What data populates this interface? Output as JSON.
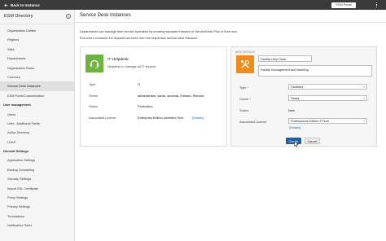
{
  "topbar": {
    "back_label": "Back to Instance",
    "portal_button": "ESM Portal"
  },
  "sidebar": {
    "title": "ESM Directory",
    "help_icon": "?",
    "items": [
      {
        "label": "Organization Details",
        "type": "item"
      },
      {
        "label": "Regions",
        "type": "item"
      },
      {
        "label": "Sites",
        "type": "item"
      },
      {
        "label": "Departments",
        "type": "item"
      },
      {
        "label": "Organization Roles",
        "type": "item"
      },
      {
        "label": "Currency",
        "type": "item"
      },
      {
        "label": "Service Desk Instances",
        "type": "item",
        "active": true
      },
      {
        "label": "ESM Portal Customization",
        "type": "item"
      },
      {
        "label": "User management",
        "type": "head"
      },
      {
        "label": "Users",
        "type": "item"
      },
      {
        "label": "User - Additional Fields",
        "type": "item"
      },
      {
        "label": "Active Directory",
        "type": "item"
      },
      {
        "label": "LDAP",
        "type": "item"
      },
      {
        "label": "General Settings",
        "type": "head"
      },
      {
        "label": "Application Settings",
        "type": "item"
      },
      {
        "label": "Backup Scheduling",
        "type": "item"
      },
      {
        "label": "Security Settings",
        "type": "item"
      },
      {
        "label": "Import SSL Certificate",
        "type": "item"
      },
      {
        "label": "Proxy Settings",
        "type": "item"
      },
      {
        "label": "Privacy Settings",
        "type": "item"
      },
      {
        "label": "Translations",
        "type": "item"
      },
      {
        "label": "Notification Rules",
        "type": "item"
      }
    ]
  },
  "main": {
    "title": "Service Desk Instances",
    "description_line1": "Departments can manage their service operation by creating separate instance of ServiceDesk Plus of their own.",
    "description_line2": "End users consume the required services from the respective service desk instance."
  },
  "left_card": {
    "name": "IT Helpdesk",
    "subtitle": "Helpdesk to manage all IT support",
    "fields": [
      {
        "label": "Type",
        "value": "IT"
      },
      {
        "label": "Owner",
        "value": "administrator, santa, amanda, Edward, Richard"
      },
      {
        "label": "Status",
        "value": "Production"
      },
      {
        "label": "Associated License",
        "value": "Enterprise Edition unlimited Tech",
        "link": "[Details]"
      }
    ],
    "logo_color": "#6db33f"
  },
  "right_card": {
    "badge": "NEW INSTANCE",
    "name_value": "Facility Help Desk",
    "description_value": "Facility management and ticketing",
    "type_label": "Type",
    "type_value": "Facilities",
    "owner_label": "Owner",
    "owner_value": "Santa",
    "status_label": "Status",
    "status_value": "New",
    "license_label": "Associated License",
    "license_value": "Professional Edition 5 Tech",
    "license_link": "[Details]",
    "required_mark": "*",
    "logo_color": "#f08c1e",
    "create_label": "Create",
    "cancel_label": "Cancel"
  },
  "colors": {
    "topbar": "#3b3b3b",
    "primary": "#1f5f9e",
    "link": "#2b6cb0"
  }
}
